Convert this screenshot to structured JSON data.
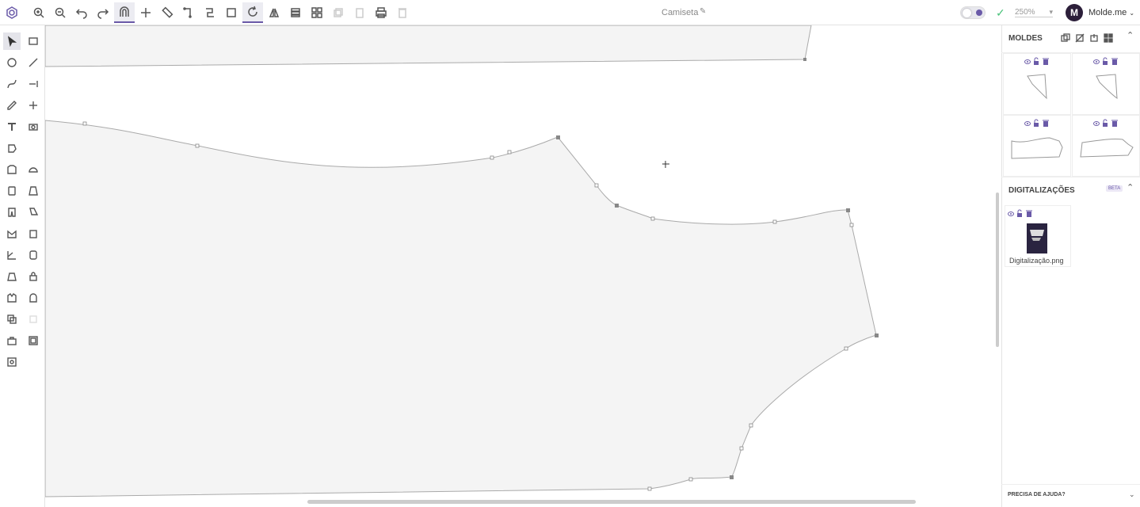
{
  "document": {
    "title": "Camiseta"
  },
  "zoom": {
    "level": "250%"
  },
  "user": {
    "initial": "M",
    "name": "Molde.me"
  },
  "panels": {
    "moldes": {
      "title": "MOLDES"
    },
    "digitalizacoes": {
      "title": "DIGITALIZAÇÕES",
      "badge": "BETA",
      "file_name": "Digitalização.png"
    },
    "help": {
      "label": "PRECISA DE AJUDA?"
    }
  },
  "toolbar": {
    "icons": [
      "app-logo-icon",
      "zoom-in-icon",
      "zoom-out-icon",
      "undo-icon",
      "redo-icon",
      "magnet-icon",
      "add-point-icon",
      "ruler-icon",
      "corner-icon",
      "curve-path-icon",
      "rectangle-select-icon",
      "rotate-icon",
      "mirror-icon",
      "layers-icon",
      "grid-icon",
      "copy-icon",
      "paste-icon",
      "print-icon",
      "delete-icon"
    ]
  },
  "colors": {
    "accent": "#6a5aa8",
    "success": "#4ac27a",
    "piece_fill": "#f4f4f4",
    "piece_stroke": "#aaaaaa"
  }
}
